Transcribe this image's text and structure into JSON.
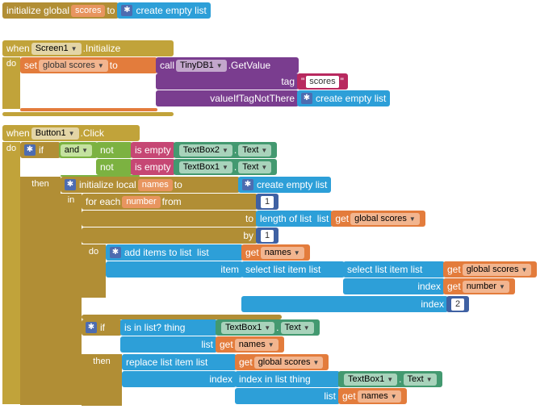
{
  "init_global": {
    "kw_init": "initialize global",
    "var": "scores",
    "kw_to": "to",
    "create_empty": "create empty list"
  },
  "screen_init": {
    "when": "when",
    "screen": "Screen1",
    "event": ".Initialize",
    "do": "do",
    "set": "set",
    "global_scores": "global scores",
    "to": "to",
    "call": "call",
    "tinydb": "TinyDB1",
    "getvalue": ".GetValue",
    "tag_lbl": "tag",
    "tag_val": "scores",
    "viftn": "valueIfTagNotThere",
    "create_empty": "create empty list"
  },
  "button_click": {
    "when": "when",
    "button": "Button1",
    "event": ".Click",
    "do": "do",
    "if": "if",
    "and": "and",
    "not": "not",
    "isempty": "is empty",
    "tb1": "TextBox1",
    "tb2": "TextBox2",
    "text": "Text",
    "then": "then",
    "init_local": "initialize local",
    "names": "names",
    "to": "to",
    "create_empty": "create empty list",
    "in": "in",
    "foreach": "for each",
    "number": "number",
    "from": "from",
    "to2": "to",
    "by": "by",
    "one": "1",
    "two": "2",
    "lenlist": "length of list",
    "list": "list",
    "get": "get",
    "global_scores": "global scores",
    "do2": "do",
    "additems": "add items to list",
    "item": "item",
    "select": "select list item  list",
    "index": "index",
    "if2": "if",
    "isinlist": "is in list?  thing",
    "then2": "then",
    "replace": "replace list item  list",
    "indexinlist": "index in list  thing",
    "dot": "."
  }
}
